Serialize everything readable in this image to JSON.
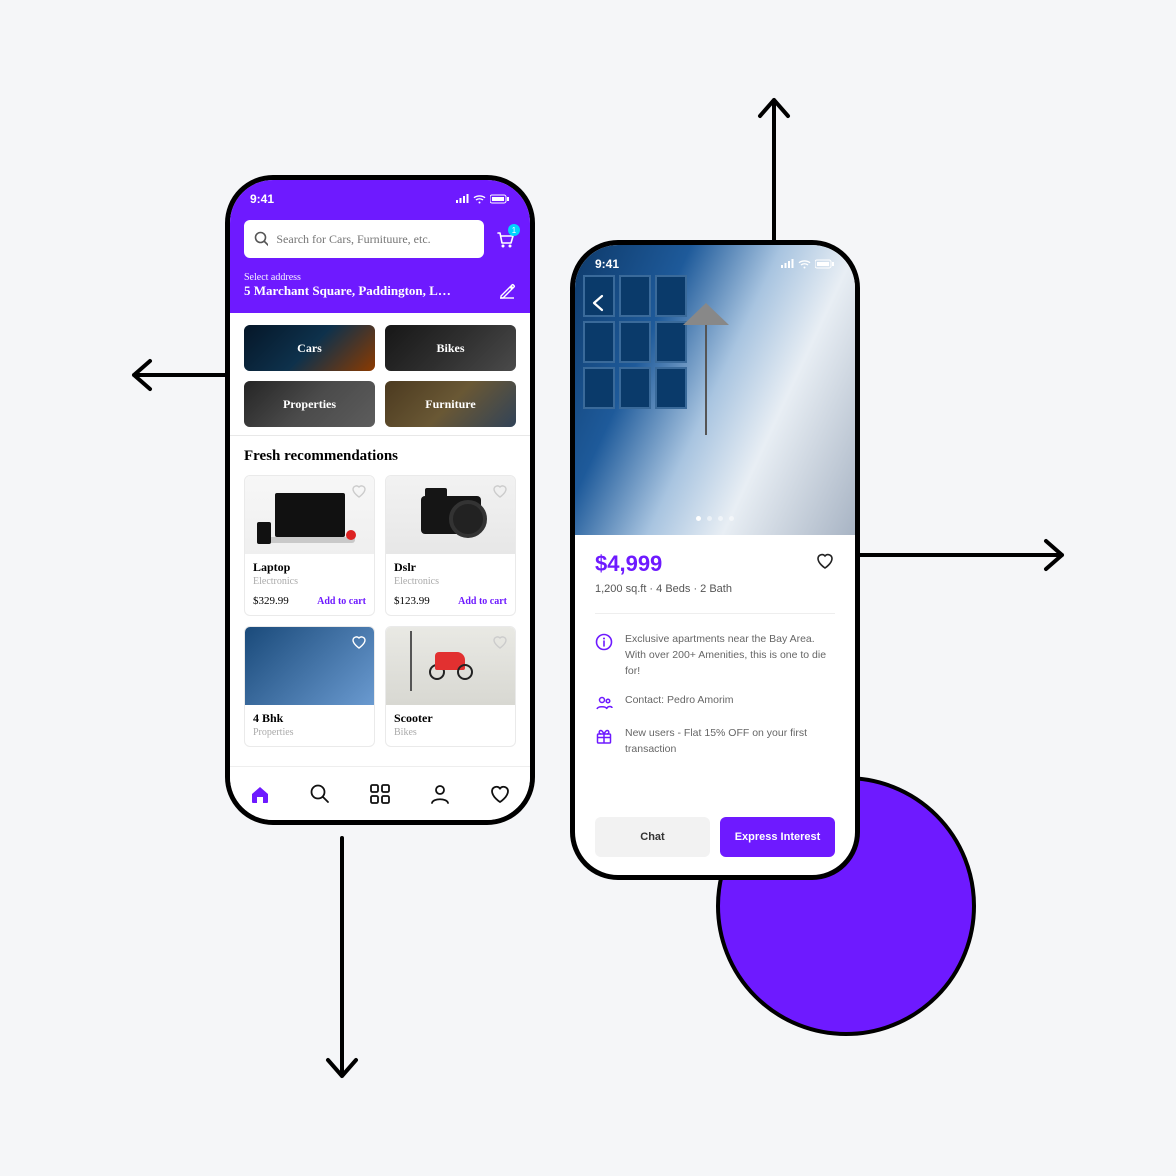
{
  "colors": {
    "accent": "#6e1aff"
  },
  "statusbar": {
    "time": "9:41"
  },
  "phoneA": {
    "search": {
      "placeholder": "Search for Cars, Furnituure, etc."
    },
    "cart": {
      "badge": "1"
    },
    "address": {
      "label": "Select address",
      "value": "5 Marchant Square, Paddington, L…"
    },
    "categories": [
      {
        "label": "Cars"
      },
      {
        "label": "Bikes"
      },
      {
        "label": "Properties"
      },
      {
        "label": "Furniture"
      }
    ],
    "section_title": "Fresh recommendations",
    "products": [
      {
        "name": "Laptop",
        "category": "Electronics",
        "price": "$329.99",
        "cta": "Add to cart"
      },
      {
        "name": "Dslr",
        "category": "Electronics",
        "price": "$123.99",
        "cta": "Add to cart"
      },
      {
        "name": "4 Bhk",
        "category": "Properties",
        "price": "",
        "cta": ""
      },
      {
        "name": "Scooter",
        "category": "Bikes",
        "price": "",
        "cta": ""
      }
    ]
  },
  "phoneB": {
    "price": "$4,999",
    "stats": "1,200 sq.ft  ·  4 Beds  ·  2 Bath",
    "features": [
      "Exclusive apartments near the Bay Area. With over 200+ Amenities, this is one to die for!",
      "Contact: Pedro Amorim",
      "New users - Flat 15% OFF on your first transaction"
    ],
    "actions": {
      "chat": "Chat",
      "primary": "Express Interest"
    }
  }
}
